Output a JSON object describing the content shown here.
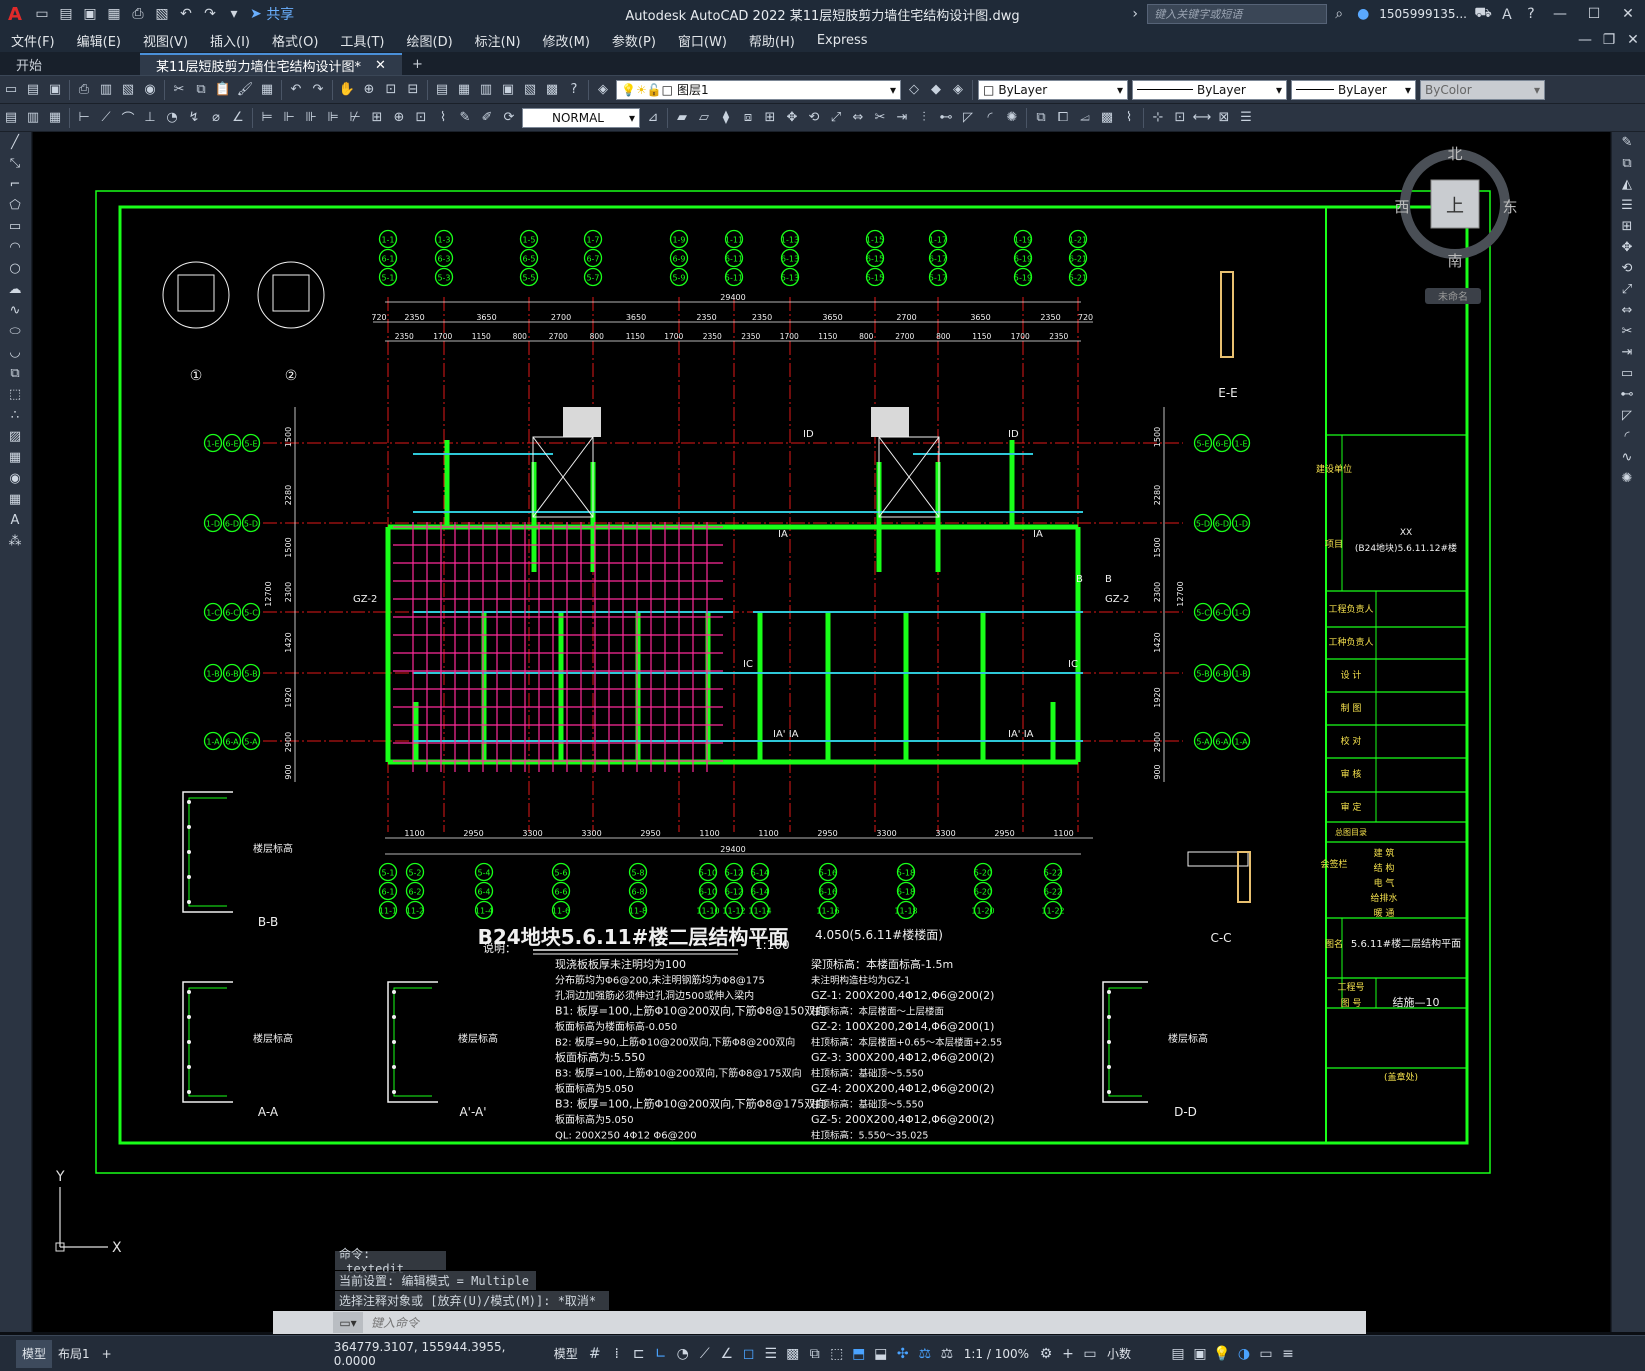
{
  "app": {
    "logo": "A",
    "title": "Autodesk AutoCAD 2022    某11层短肢剪力墙住宅结构设计图.dwg",
    "search_placeholder": "键入关键字或短语",
    "user": "1505999135...",
    "share": "共享"
  },
  "menus": [
    "文件(F)",
    "编辑(E)",
    "视图(V)",
    "插入(I)",
    "格式(O)",
    "工具(T)",
    "绘图(D)",
    "标注(N)",
    "修改(M)",
    "参数(P)",
    "窗口(W)",
    "帮助(H)",
    "Express"
  ],
  "tabs": [
    {
      "label": "开始"
    },
    {
      "label": "某11层短肢剪力墙住宅结构设计图*"
    }
  ],
  "toolbar1": {
    "layer": "图层1",
    "color": "ByLayer",
    "linetype": "ByLayer",
    "lineweight": "ByLayer",
    "plotstyle": "ByColor"
  },
  "toolbar2": {
    "textstyle": "NORMAL"
  },
  "viewcube": {
    "north": "北",
    "south": "南",
    "east": "东",
    "west": "西",
    "top": "上",
    "ucs": "未命名"
  },
  "drawing": {
    "title": "B24地块5.6.11#楼二层结构平面",
    "scale": "1:100",
    "elev": "4.050(5.6.11#楼楼面)",
    "notes_label": "说明：",
    "notes_left": [
      "现浇板板厚未注明均为100",
      "分布筋均为Φ6@200,未注明钢筋均为Φ8@175",
      "孔洞边加强筋必须伸过孔洞边500或伸入梁内",
      "B1: 板厚=100,上筋Φ10@200双向,下筋Φ8@150双向",
      "板面标高为楼面标高-0.050",
      "B2: 板厚=90,上筋Φ10@200双向,下筋Φ8@200双向",
      "板面标高为:5.550",
      "B3: 板厚=100,上筋Φ10@200双向,下筋Φ8@175双向",
      "板面标高为5.050",
      "B3: 板厚=100,上筋Φ10@200双向,下筋Φ8@175双向",
      "板面标高为5.050",
      "QL: 200X250 4Φ12 Φ6@200"
    ],
    "notes_right": [
      "梁顶标高：本楼面标高-1.5m",
      "未注明构造柱均为GZ-1",
      "GZ-1: 200X200,4Φ12,Φ6@200(2)",
      "柱顶标高：本层楼面～上层楼面",
      "GZ-2: 100X200,2Φ14,Φ6@200(1)",
      "柱顶标高：本层楼面+0.65～本层楼面+2.55",
      "GZ-3: 300X200,4Φ12,Φ6@200(2)",
      "柱顶标高：基础顶～5.550",
      "GZ-4: 200X200,4Φ12,Φ6@200(2)",
      "柱顶标高：基础顶～5.550",
      "GZ-5: 200X200,4Φ12,Φ6@200(2)",
      "柱顶标高：5.550～35.025"
    ],
    "total_dim": "29400",
    "top_dims": [
      "720",
      "2350",
      "3650",
      "2700",
      "3650",
      "2350",
      "2350",
      "3650",
      "2700",
      "3650",
      "2350",
      "720"
    ],
    "top_dims2": [
      "2350",
      "1700",
      "1150",
      "800",
      "2700",
      "800",
      "1150",
      "1700",
      "2350",
      "2350",
      "1700",
      "1150",
      "800",
      "2700",
      "800",
      "1150",
      "1700",
      "2350"
    ],
    "bottom_dims": [
      "1100",
      "2950",
      "3300",
      "3300",
      "2950",
      "1100",
      "1100",
      "2950",
      "3300",
      "3300",
      "2950",
      "1100"
    ],
    "left_dims": [
      "1500",
      "2280",
      "1500",
      "2300",
      "1420",
      "1920",
      "2900",
      "900"
    ],
    "left_total": "12700",
    "axes_top1": [
      "1-1",
      "1-3",
      "1-5",
      "1-7",
      "1-9",
      "1-11",
      "1-13",
      "1-15",
      "1-17",
      "1-19",
      "1-21"
    ],
    "axes_top2": [
      "6-1",
      "6-3",
      "6-5",
      "6-7",
      "6-9",
      "6-11",
      "6-13",
      "6-15",
      "6-17",
      "6-19",
      "6-21"
    ],
    "axes_top3": [
      "5-1",
      "5-3",
      "5-5",
      "5-7",
      "5-9",
      "5-11",
      "5-13",
      "5-15",
      "5-17",
      "5-19",
      "5-21"
    ],
    "axes_bot1": [
      "5-1",
      "5-2",
      "5-4",
      "5-6",
      "5-8",
      "5-10",
      "5-12",
      "5-14",
      "5-16",
      "5-18",
      "5-20",
      "5-22"
    ],
    "axes_bot2": [
      "6-1",
      "6-2",
      "6-4",
      "6-6",
      "6-8",
      "6-10",
      "6-12",
      "6-14",
      "6-16",
      "6-18",
      "6-20",
      "6-22"
    ],
    "axes_bot3": [
      "11-1",
      "11-2",
      "11-4",
      "11-6",
      "11-8",
      "11-10",
      "11-12",
      "11-14",
      "11-16",
      "11-18",
      "11-20",
      "11-22"
    ],
    "axes_left": [
      [
        "1-E",
        "6-E",
        "5-E"
      ],
      [
        "1-D",
        "6-D",
        "5-D"
      ],
      [
        "1-C",
        "6-C",
        "5-C"
      ],
      [
        "1-B",
        "6-B",
        "5-B"
      ],
      [
        "1-A",
        "6-A",
        "5-A"
      ]
    ],
    "sections": [
      "①",
      "②",
      "B-B",
      "A-A",
      "A'-A'",
      "C-C",
      "D-D",
      "E-E"
    ],
    "floor_label": "楼层标高",
    "titleblock": {
      "unit_label": "建设单位",
      "proj_label": "项目",
      "proj": "XX\n(B24地块)5.6.11.12#楼",
      "rows": [
        "工程负责人",
        "工种负责人",
        "设 计",
        "制 图",
        "校 对",
        "审 核",
        "审 定"
      ],
      "countersign": "会签栏",
      "disciplines": [
        "建 筑",
        "结 构",
        "电 气",
        "给排水",
        "暖 通"
      ],
      "drawing_label": "图名",
      "drawing_name": "5.6.11#楼二层结构平面",
      "proj_no": "工程号",
      "sheet_no_label": "图 号",
      "sheet_no": "结施—10",
      "seal": "(盖章处)",
      "total_label": "总图目录"
    }
  },
  "command": {
    "line1": "命令: _textedit",
    "line2": "当前设置: 编辑模式 = Multiple",
    "line3": "选择注释对象或 [放弃(U)/模式(M)]: *取消*",
    "input_placeholder": "键入命令"
  },
  "status": {
    "tabs": [
      "模型",
      "布局1"
    ],
    "coords": "364779.3107, 155944.3955, 0.0000",
    "space": "模型",
    "scale": "1:1 / 100%",
    "units": "小数"
  }
}
